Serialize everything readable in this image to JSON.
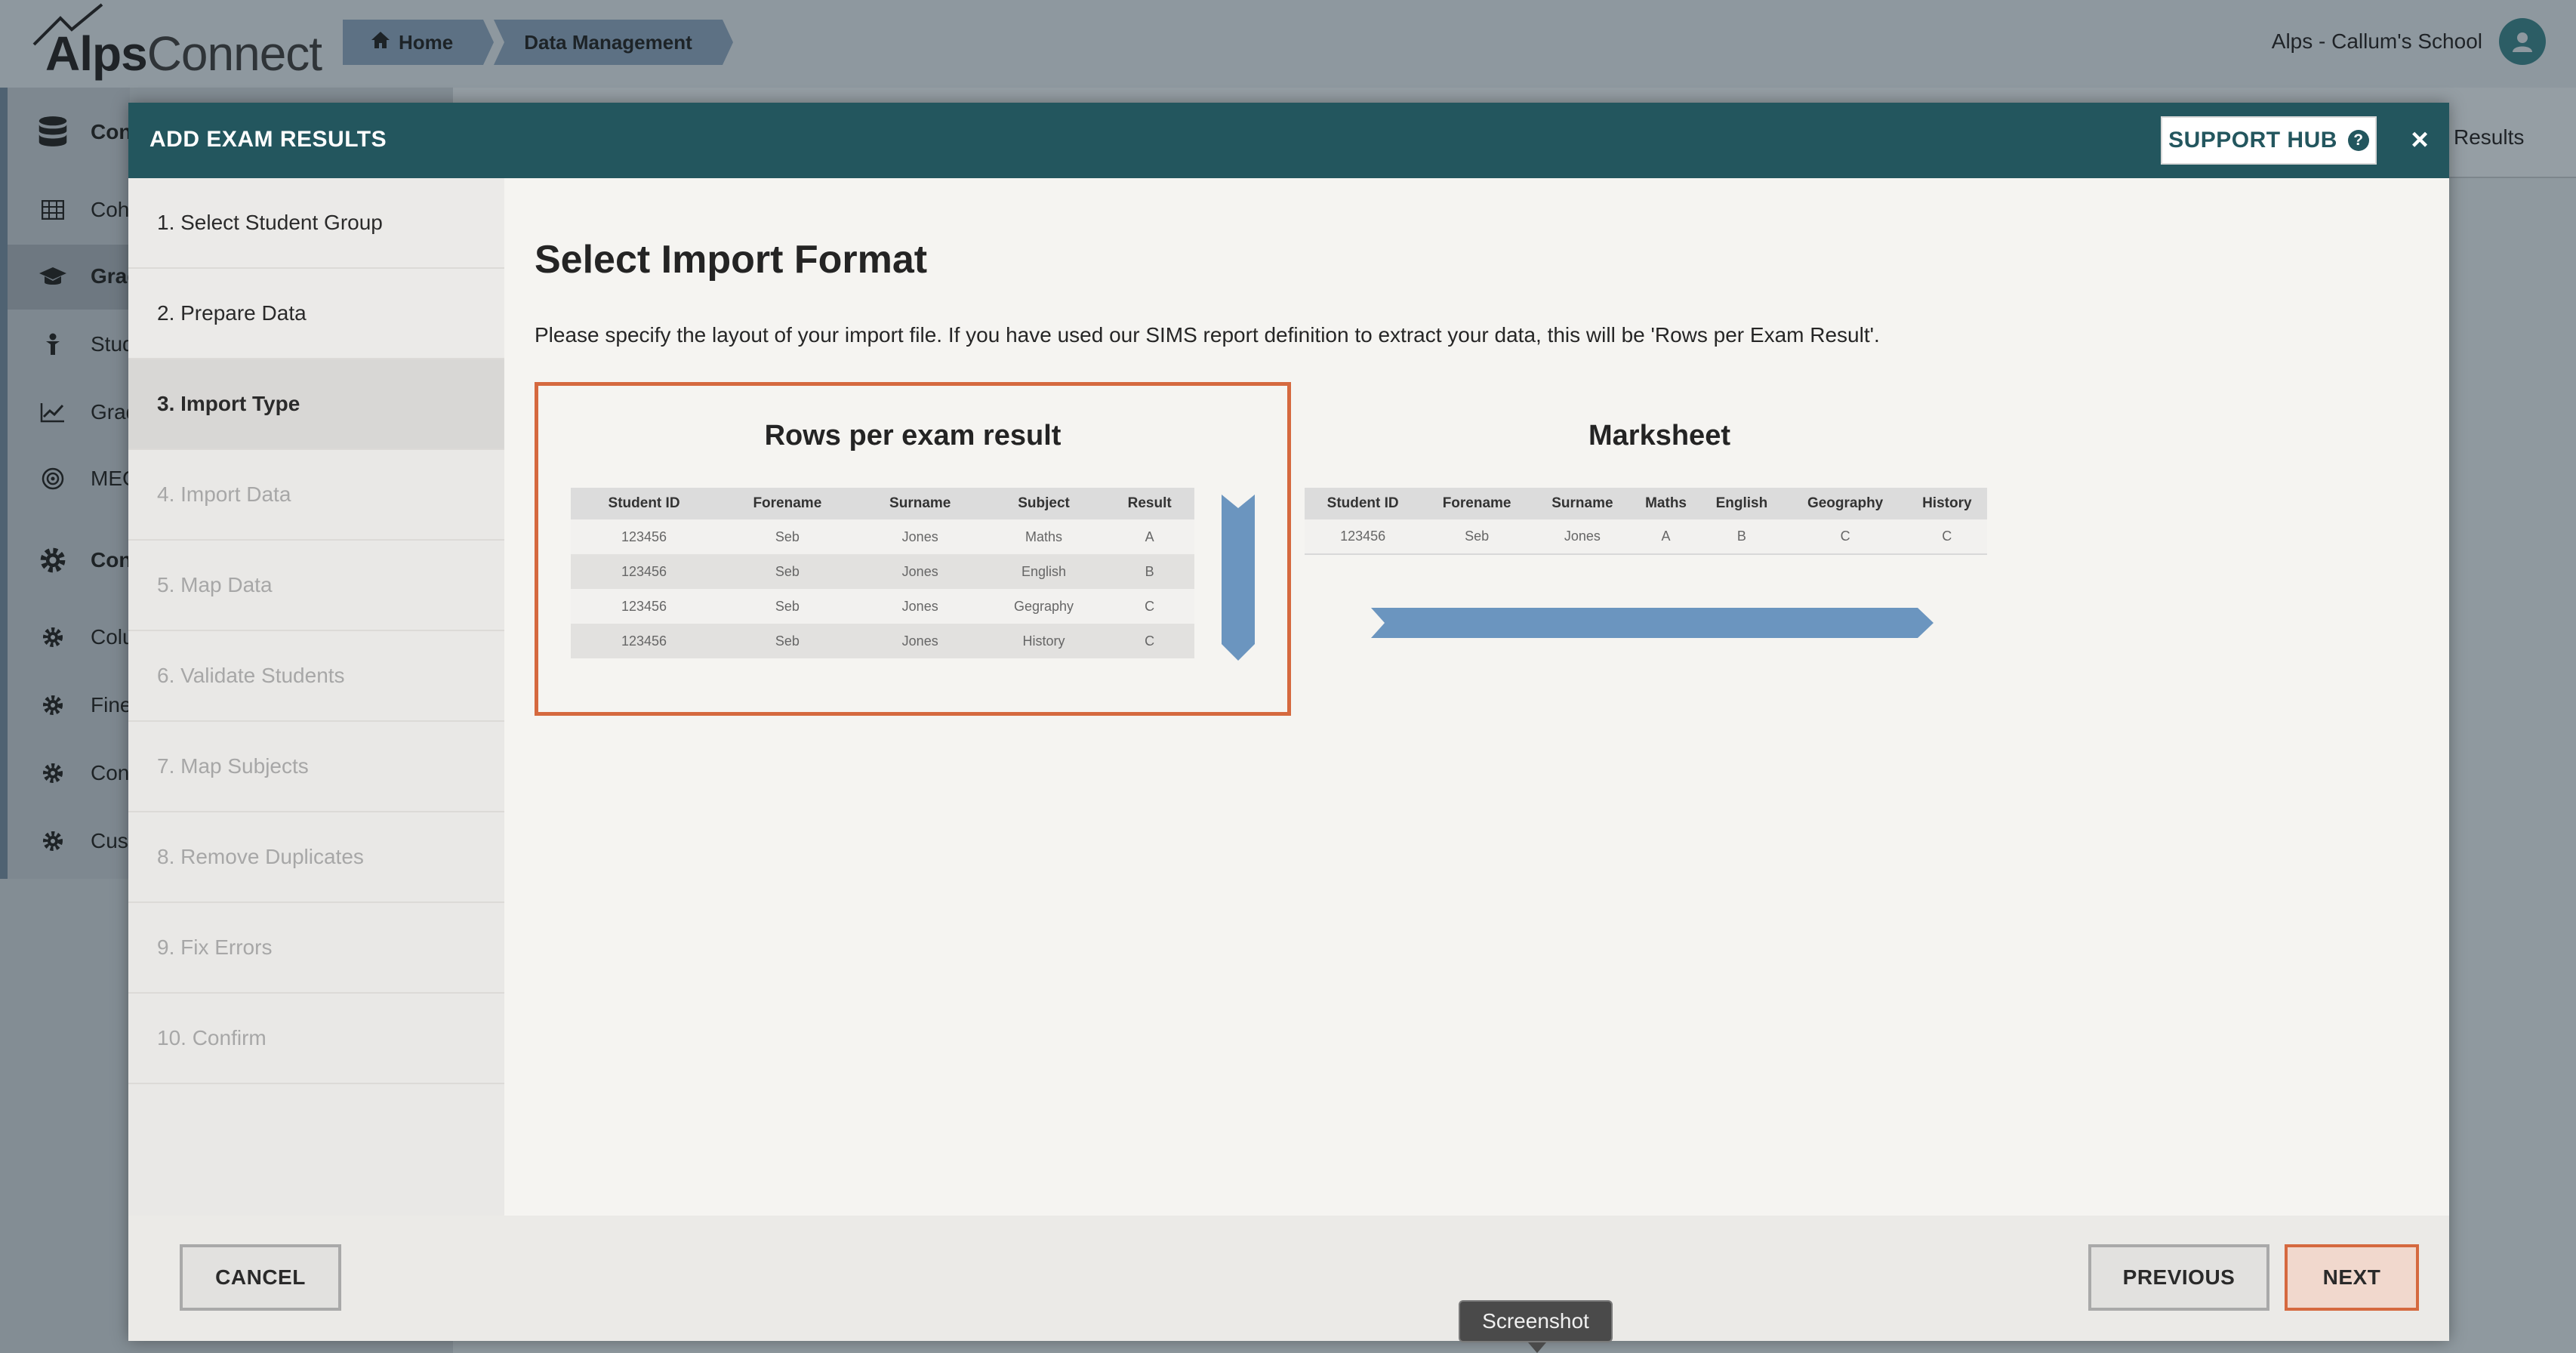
{
  "app": {
    "logo_bold": "Alps",
    "logo_light": "Connect",
    "user_name": "Alps - Callum's School",
    "breadcrumb": [
      {
        "label": "Home",
        "icon": "home-icon"
      },
      {
        "label": "Data Management"
      }
    ],
    "nav": [
      {
        "label": "Con",
        "icon": "database-icon",
        "bold": true
      },
      {
        "label": "Coh",
        "icon": "table-icon"
      },
      {
        "label": "Grad",
        "icon": "graduation-cap-icon",
        "bold": true
      },
      {
        "label": "Stud",
        "icon": "student-icon"
      },
      {
        "label": "Grad",
        "icon": "line-chart-icon"
      },
      {
        "label": "MEG",
        "icon": "target-icon"
      },
      {
        "label": "Con",
        "icon": "gear-icon",
        "bold": true
      },
      {
        "label": "Colu",
        "icon": "gear-icon"
      },
      {
        "label": "Fine",
        "icon": "gear-icon"
      },
      {
        "label": "Con",
        "icon": "gear-icon"
      },
      {
        "label": "Cust",
        "icon": "gear-icon"
      }
    ],
    "background_results_label": "Results"
  },
  "modal": {
    "title": "ADD EXAM RESULTS",
    "support_hub_label": "SUPPORT HUB",
    "close_symbol": "×",
    "steps": [
      {
        "label": "1. Select Student Group",
        "state": "done"
      },
      {
        "label": "2. Prepare Data",
        "state": "done"
      },
      {
        "label": "3. Import Type",
        "state": "active"
      },
      {
        "label": "4. Import Data",
        "state": "pending"
      },
      {
        "label": "5. Map Data",
        "state": "pending"
      },
      {
        "label": "6. Validate Students",
        "state": "pending"
      },
      {
        "label": "7. Map Subjects",
        "state": "pending"
      },
      {
        "label": "8. Remove Duplicates",
        "state": "pending"
      },
      {
        "label": "9. Fix Errors",
        "state": "pending"
      },
      {
        "label": "10. Confirm",
        "state": "pending"
      }
    ],
    "main": {
      "title": "Select Import Format",
      "description": "Please specify the layout of your import file. If you have used our SIMS report definition to extract your data, this will be 'Rows per Exam Result'.",
      "formats": [
        {
          "title": "Rows per exam result",
          "selected": true,
          "headers": [
            "Student ID",
            "Forename",
            "Surname",
            "Subject",
            "Result"
          ],
          "rows": [
            [
              "123456",
              "Seb",
              "Jones",
              "Maths",
              "A"
            ],
            [
              "123456",
              "Seb",
              "Jones",
              "English",
              "B"
            ],
            [
              "123456",
              "Seb",
              "Jones",
              "Gegraphy",
              "C"
            ],
            [
              "123456",
              "Seb",
              "Jones",
              "History",
              "C"
            ]
          ],
          "arrow": "down"
        },
        {
          "title": "Marksheet",
          "selected": false,
          "headers": [
            "Student ID",
            "Forename",
            "Surname",
            "Maths",
            "English",
            "Geography",
            "History"
          ],
          "rows": [
            [
              "123456",
              "Seb",
              "Jones",
              "A",
              "B",
              "C",
              "C"
            ]
          ],
          "arrow": "right"
        }
      ]
    },
    "footer": {
      "cancel_label": "CANCEL",
      "previous_label": "PREVIOUS",
      "next_label": "NEXT"
    }
  },
  "tooltip": "Screenshot",
  "colors": {
    "header_teal": "#23565e",
    "accent_orange": "#d5693f",
    "arrow_blue": "#6b95bf"
  }
}
